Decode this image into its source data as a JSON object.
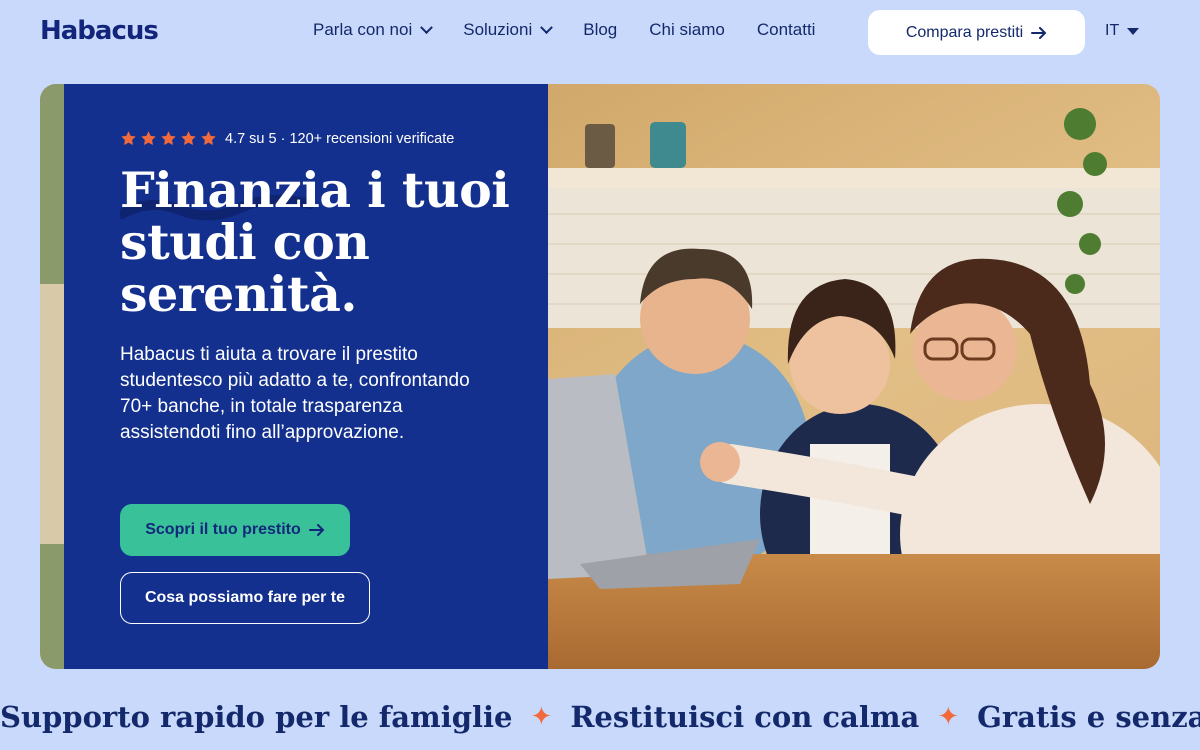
{
  "header": {
    "logo": "Habacus",
    "nav": [
      {
        "label": "Parla con noi",
        "has_dropdown": true
      },
      {
        "label": "Soluzioni",
        "has_dropdown": true
      },
      {
        "label": "Blog",
        "has_dropdown": false
      },
      {
        "label": "Chi siamo",
        "has_dropdown": false
      },
      {
        "label": "Contatti",
        "has_dropdown": false
      }
    ],
    "compare_button": "Compara prestiti",
    "language": "IT"
  },
  "hero": {
    "rating": {
      "stars": 5,
      "text": "4.7 su 5 · 120+ recensioni verificate"
    },
    "headline": "Finanzia i tuoi studi con serenità.",
    "description": "Habacus ti aiuta a trovare il prestito studentesco più adatto a te, confrontando 70+ banche, in totale trasparenza assistendoti fino all’approvazione.",
    "cta_primary": "Scopri il tuo prestito",
    "cta_secondary": "Cosa possiamo fare per te"
  },
  "marquee": [
    "Supporto rapido per le famiglie",
    "Restituisci con calma",
    "Gratis e senza imp"
  ],
  "colors": {
    "page_bg": "#c9d9fb",
    "panel_bg": "#13308f",
    "brand_navy": "#14296b",
    "cta_green": "#39c29a",
    "star_orange": "#f26a3c"
  }
}
